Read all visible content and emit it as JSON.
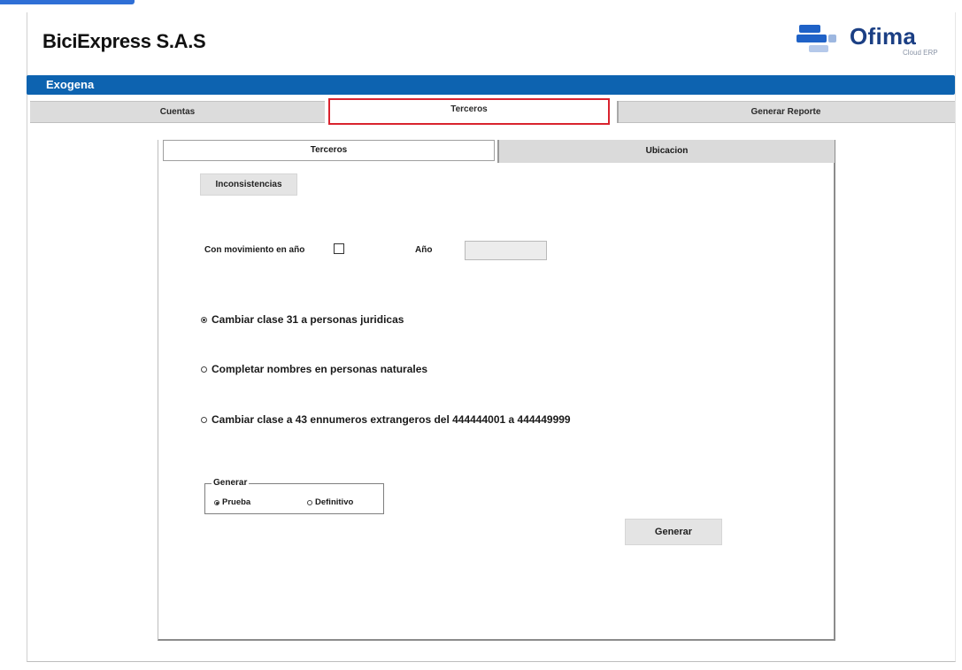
{
  "header": {
    "company": "BiciExpress S.A.S",
    "logo": {
      "name": "Ofima",
      "subtitle": "Cloud ERP",
      "icon": "ofima-logo-icon",
      "brand_color": "#1f62c7"
    }
  },
  "module": {
    "title": "Exogena",
    "color": "#0d63b0"
  },
  "main_tabs": [
    {
      "label": "Cuentas",
      "active": false
    },
    {
      "label": "Terceros",
      "active": true
    },
    {
      "label": "Generar Reporte",
      "active": false
    }
  ],
  "sub_tabs": [
    {
      "label": "Terceros",
      "active": true
    },
    {
      "label": "Ubicacion",
      "active": false
    }
  ],
  "form": {
    "inconsistencias_label": "Inconsistencias",
    "con_movimiento_label": "Con movimiento en año",
    "con_movimiento_checked": false,
    "anio_label": "Año",
    "anio_value": "",
    "options": [
      {
        "label": "Cambiar clase 31 a personas juridicas",
        "selected": true
      },
      {
        "label": "Completar nombres en personas naturales",
        "selected": false
      },
      {
        "label": "Cambiar clase a 43 ennumeros extrangeros del  444444001 a 444449999",
        "selected": false
      }
    ],
    "generar_group": {
      "title": "Generar",
      "options": [
        {
          "label": "Prueba",
          "selected": true
        },
        {
          "label": "Definitivo",
          "selected": false
        }
      ]
    },
    "generar_button": "Generar"
  },
  "colors": {
    "active_tab_border": "#d9232e",
    "accent": "#2f6fd6"
  }
}
